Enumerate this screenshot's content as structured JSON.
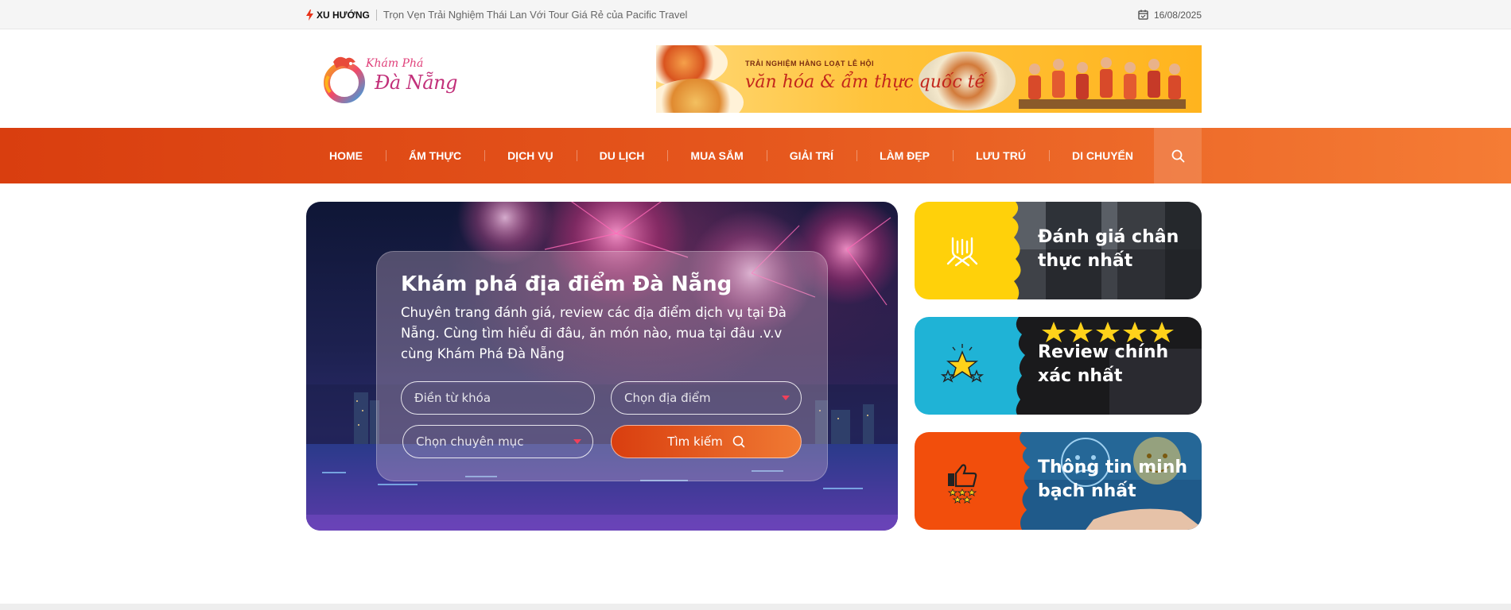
{
  "topbar": {
    "trending_label": "XU HƯỚNG",
    "trending_text": "Trọn Vẹn Trải Nghiệm Thái Lan Với Tour Giá Rẻ của Pacific Travel",
    "date": "16/08/2025"
  },
  "logo": {
    "line1": "Khám Phá",
    "line2": "Đà Nẵng"
  },
  "banner": {
    "small": "TRẢI NGHIỆM HÀNG LOẠT LỄ HỘI",
    "big": "văn hóa & ẩm thực quốc tế"
  },
  "nav": {
    "items": [
      "HOME",
      "ẨM THỰC",
      "DỊCH VỤ",
      "DU LỊCH",
      "MUA SẮM",
      "GIẢI TRÍ",
      "LÀM ĐẸP",
      "LƯU TRÚ",
      "DI CHUYỂN"
    ]
  },
  "hero": {
    "title": "Khám phá địa điểm Đà Nẵng",
    "description": "Chuyên trang đánh giá, review các địa điểm dịch vụ tại Đà Nẵng. Cùng tìm hiểu đi đâu, ăn món nào, mua tại đâu .v.v cùng Khám Phá Đà Nẵng",
    "keyword_placeholder": "Điền từ khóa",
    "location_placeholder": "Chọn địa điểm",
    "category_placeholder": "Chọn chuyên mục",
    "search_button": "Tìm kiếm"
  },
  "cards": [
    {
      "title": "Đánh giá chân thực nhất",
      "color": "#ffd10a"
    },
    {
      "title": "Review chính xác nhất",
      "color": "#1fb3d6"
    },
    {
      "title": "Thông tin minh bạch nhất",
      "color": "#f24e0c"
    }
  ],
  "colors": {
    "accent": "#e5571d",
    "nav_start": "#d93e0f",
    "nav_end": "#f57c35"
  }
}
